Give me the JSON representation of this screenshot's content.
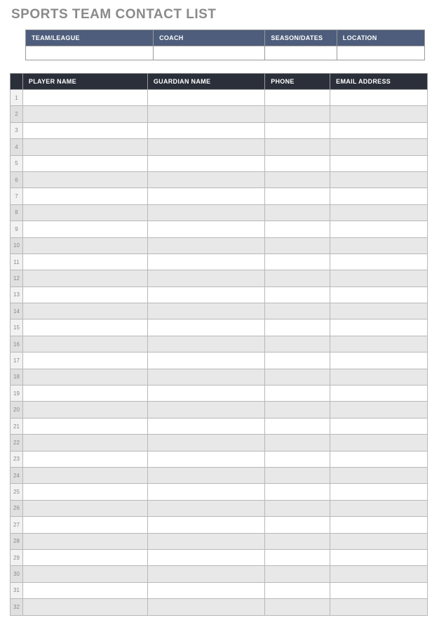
{
  "title": "SPORTS TEAM CONTACT LIST",
  "info": {
    "headers": {
      "team": "TEAM/LEAGUE",
      "coach": "COACH",
      "season": "SEASON/DATES",
      "location": "LOCATION"
    },
    "values": {
      "team": "",
      "coach": "",
      "season": "",
      "location": ""
    }
  },
  "roster": {
    "headers": {
      "num": "",
      "player": "PLAYER NAME",
      "guardian": "GUARDIAN NAME",
      "phone": "PHONE",
      "email": "EMAIL ADDRESS"
    },
    "rows": [
      {
        "num": "1",
        "player": "",
        "guardian": "",
        "phone": "",
        "email": ""
      },
      {
        "num": "2",
        "player": "",
        "guardian": "",
        "phone": "",
        "email": ""
      },
      {
        "num": "3",
        "player": "",
        "guardian": "",
        "phone": "",
        "email": ""
      },
      {
        "num": "4",
        "player": "",
        "guardian": "",
        "phone": "",
        "email": ""
      },
      {
        "num": "5",
        "player": "",
        "guardian": "",
        "phone": "",
        "email": ""
      },
      {
        "num": "6",
        "player": "",
        "guardian": "",
        "phone": "",
        "email": ""
      },
      {
        "num": "7",
        "player": "",
        "guardian": "",
        "phone": "",
        "email": ""
      },
      {
        "num": "8",
        "player": "",
        "guardian": "",
        "phone": "",
        "email": ""
      },
      {
        "num": "9",
        "player": "",
        "guardian": "",
        "phone": "",
        "email": ""
      },
      {
        "num": "10",
        "player": "",
        "guardian": "",
        "phone": "",
        "email": ""
      },
      {
        "num": "11",
        "player": "",
        "guardian": "",
        "phone": "",
        "email": ""
      },
      {
        "num": "12",
        "player": "",
        "guardian": "",
        "phone": "",
        "email": ""
      },
      {
        "num": "13",
        "player": "",
        "guardian": "",
        "phone": "",
        "email": ""
      },
      {
        "num": "14",
        "player": "",
        "guardian": "",
        "phone": "",
        "email": ""
      },
      {
        "num": "15",
        "player": "",
        "guardian": "",
        "phone": "",
        "email": ""
      },
      {
        "num": "16",
        "player": "",
        "guardian": "",
        "phone": "",
        "email": ""
      },
      {
        "num": "17",
        "player": "",
        "guardian": "",
        "phone": "",
        "email": ""
      },
      {
        "num": "18",
        "player": "",
        "guardian": "",
        "phone": "",
        "email": ""
      },
      {
        "num": "19",
        "player": "",
        "guardian": "",
        "phone": "",
        "email": ""
      },
      {
        "num": "20",
        "player": "",
        "guardian": "",
        "phone": "",
        "email": ""
      },
      {
        "num": "21",
        "player": "",
        "guardian": "",
        "phone": "",
        "email": ""
      },
      {
        "num": "22",
        "player": "",
        "guardian": "",
        "phone": "",
        "email": ""
      },
      {
        "num": "23",
        "player": "",
        "guardian": "",
        "phone": "",
        "email": ""
      },
      {
        "num": "24",
        "player": "",
        "guardian": "",
        "phone": "",
        "email": ""
      },
      {
        "num": "25",
        "player": "",
        "guardian": "",
        "phone": "",
        "email": ""
      },
      {
        "num": "26",
        "player": "",
        "guardian": "",
        "phone": "",
        "email": ""
      },
      {
        "num": "27",
        "player": "",
        "guardian": "",
        "phone": "",
        "email": ""
      },
      {
        "num": "28",
        "player": "",
        "guardian": "",
        "phone": "",
        "email": ""
      },
      {
        "num": "29",
        "player": "",
        "guardian": "",
        "phone": "",
        "email": ""
      },
      {
        "num": "30",
        "player": "",
        "guardian": "",
        "phone": "",
        "email": ""
      },
      {
        "num": "31",
        "player": "",
        "guardian": "",
        "phone": "",
        "email": ""
      },
      {
        "num": "32",
        "player": "",
        "guardian": "",
        "phone": "",
        "email": ""
      }
    ]
  }
}
